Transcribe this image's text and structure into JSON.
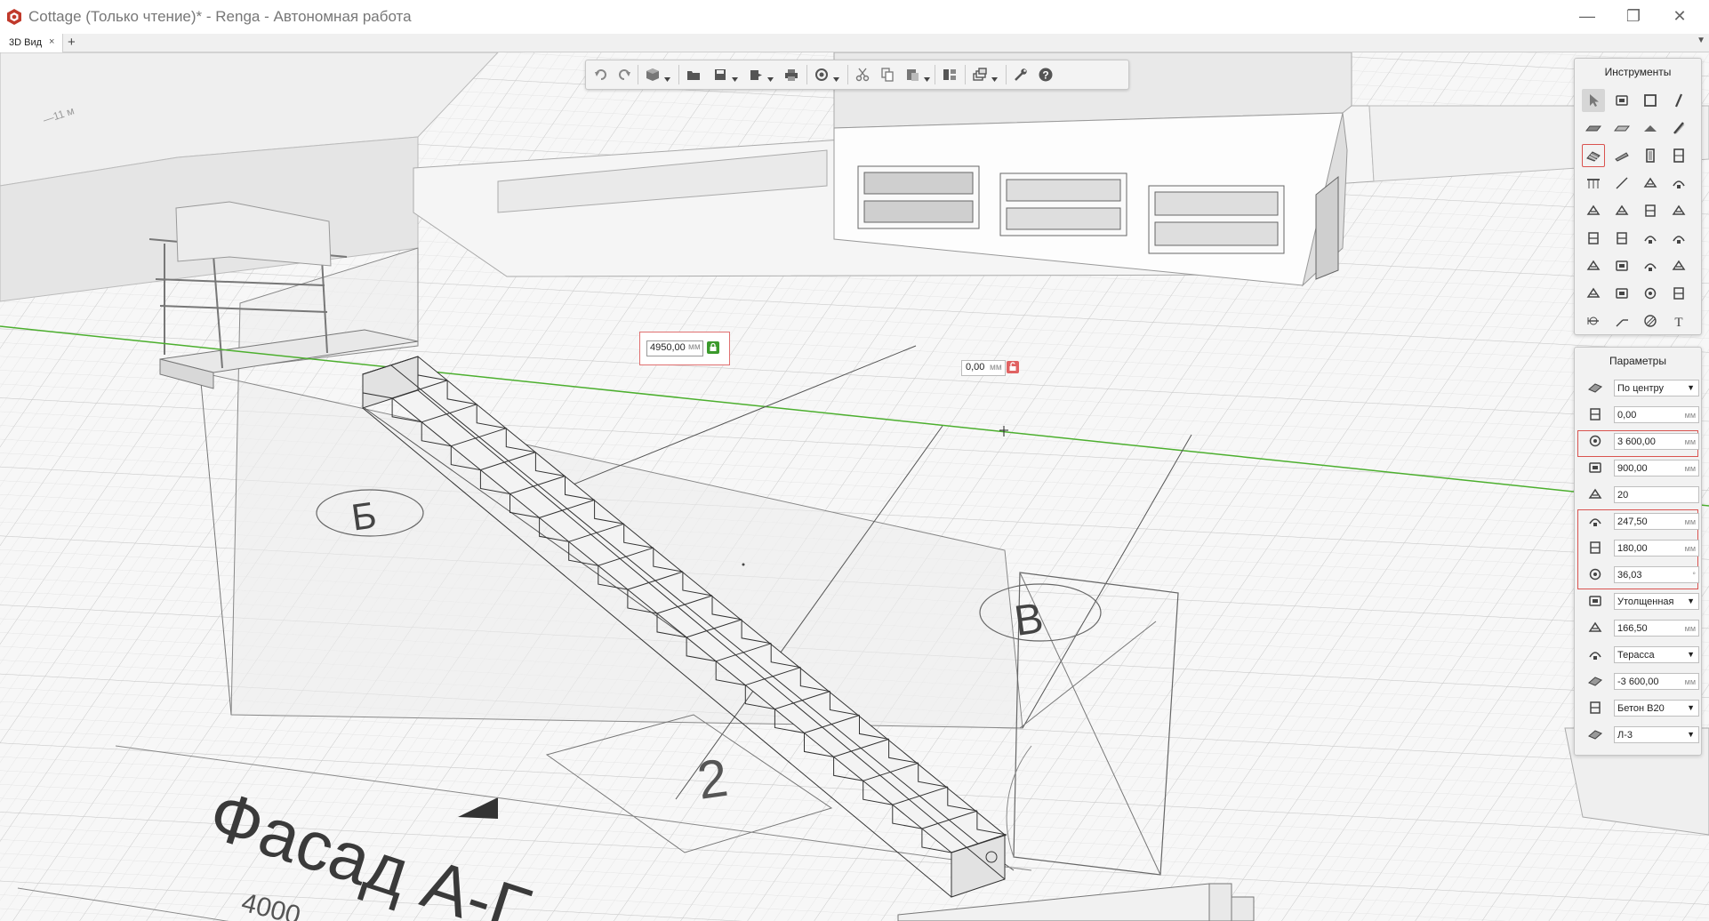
{
  "window": {
    "title": "Cottage (Только чтение)* - Renga - Автономная работа",
    "minimize": "—",
    "maximize": "❐",
    "close": "✕"
  },
  "tabs": [
    {
      "label": "3D Вид",
      "close": "×"
    }
  ],
  "tabbar": {
    "add": "+",
    "menu": "▼"
  },
  "toolbar": {
    "buttons": [
      "undo-icon",
      "redo-icon",
      "view-cube-icon",
      "open-folder-icon",
      "save-icon",
      "export-icon",
      "print-icon",
      "orbit-icon",
      "cut-icon",
      "copy-icon",
      "paste-icon",
      "properties-icon",
      "layers-icon",
      "settings-icon",
      "help-icon"
    ]
  },
  "tools_panel": {
    "title": "Инструменты",
    "tools": [
      "select-icon",
      "column-icon",
      "wall-icon",
      "beam-icon",
      "slab-icon",
      "floor-icon",
      "roof-icon",
      "rebar-icon",
      "stair-icon",
      "ramp-icon",
      "door-icon",
      "window-icon",
      "railing-icon",
      "line-icon",
      "equipment-icon",
      "pipe-icon",
      "valve-icon",
      "pump-icon",
      "fan-icon",
      "duct-icon",
      "fitting-icon",
      "boiler-icon",
      "radiator-icon",
      "filter-icon",
      "sprinkler-icon",
      "lamp-icon",
      "switch-icon",
      "panel-icon",
      "cabinet-icon",
      "sensor-icon",
      "socket-icon",
      "outlet-icon",
      "dimension-icon",
      "leader-icon",
      "hatch-icon",
      "text-icon"
    ]
  },
  "params_panel": {
    "title": "Параметры",
    "rows": [
      {
        "icon": "alignment-icon",
        "value": "По центру",
        "type": "dropdown",
        "unit": ""
      },
      {
        "icon": "offset-icon",
        "value": "0,00",
        "type": "input",
        "unit": "мм"
      },
      {
        "icon": "stair-height-icon",
        "value": "3 600,00",
        "type": "input",
        "unit": "мм"
      },
      {
        "icon": "stair-width-icon",
        "value": "900,00",
        "type": "input",
        "unit": "мм"
      },
      {
        "icon": "step-count-icon",
        "value": "20",
        "type": "input",
        "unit": ""
      },
      {
        "icon": "tread-depth-icon",
        "value": "247,50",
        "type": "input",
        "unit": "мм"
      },
      {
        "icon": "riser-height-icon",
        "value": "180,00",
        "type": "input",
        "unit": "мм"
      },
      {
        "icon": "angle-icon",
        "value": "36,03",
        "type": "input",
        "unit": "°"
      },
      {
        "icon": "stair-type-icon",
        "value": "Утолщенная",
        "type": "dropdown",
        "unit": ""
      },
      {
        "icon": "thickness-icon",
        "value": "166,50",
        "type": "input",
        "unit": "мм"
      },
      {
        "icon": "level-icon",
        "value": "Терасса",
        "type": "dropdown",
        "unit": ""
      },
      {
        "icon": "elevation-icon",
        "value": "-3 600,00",
        "type": "input",
        "unit": "мм"
      },
      {
        "icon": "material-icon",
        "value": "Бетон В20",
        "type": "dropdown",
        "unit": ""
      },
      {
        "icon": "layer-icon",
        "value": "Л-3",
        "type": "dropdown",
        "unit": ""
      }
    ]
  },
  "viewport": {
    "dimension_length": {
      "value": "4950,00",
      "unit": "мм"
    },
    "dimension_offset": {
      "value": "0,00",
      "unit": "мм"
    },
    "labels": {
      "axis_b": "Б",
      "axis_v": "В",
      "axis_2": "2",
      "facade": "Фасад А-Г",
      "dim_4000": "4000"
    }
  }
}
